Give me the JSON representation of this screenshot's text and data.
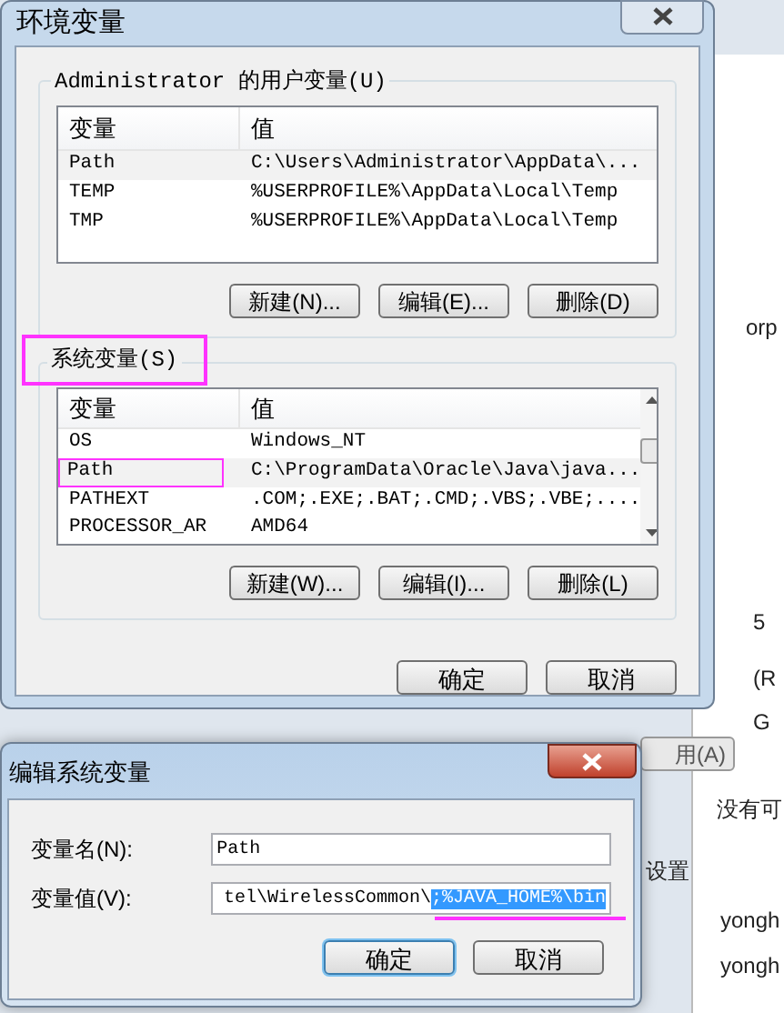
{
  "main_dialog": {
    "title": "环境变量",
    "user_group": {
      "label": "Administrator 的用户变量(U)",
      "columns": [
        "变量",
        "值"
      ],
      "rows": [
        {
          "name": "Path",
          "value": "C:\\Users\\Administrator\\AppData\\...",
          "selected": true
        },
        {
          "name": "TEMP",
          "value": "%USERPROFILE%\\AppData\\Local\\Temp",
          "selected": false
        },
        {
          "name": "TMP",
          "value": "%USERPROFILE%\\AppData\\Local\\Temp",
          "selected": false
        }
      ],
      "buttons": [
        "新建(N)...",
        "编辑(E)...",
        "删除(D)"
      ]
    },
    "system_group": {
      "label": "系统变量(S)",
      "columns": [
        "变量",
        "值"
      ],
      "rows": [
        {
          "name": "OS",
          "value": "Windows_NT",
          "selected": false
        },
        {
          "name": "Path",
          "value": "C:\\ProgramData\\Oracle\\Java\\java...",
          "selected": true
        },
        {
          "name": "PATHEXT",
          "value": ".COM;.EXE;.BAT;.CMD;.VBS;.VBE;....",
          "selected": false
        },
        {
          "name": "PROCESSOR_AR",
          "value": "AMD64",
          "selected": false
        }
      ],
      "buttons": [
        "新建(W)...",
        "编辑(I)...",
        "删除(L)"
      ]
    },
    "buttons": [
      "确定",
      "取消"
    ]
  },
  "edit_dialog": {
    "title": "编辑系统变量",
    "fields": [
      {
        "label": "变量名(N):",
        "value": "Path"
      },
      {
        "label": "变量值(V):",
        "value": "tel\\WirelessCommon\\",
        "selected_text": ";%JAVA_HOME%\\bin"
      }
    ],
    "buttons": [
      "确定",
      "取消"
    ]
  },
  "background": {
    "apply_button": "用(A)",
    "fragments": [
      "orp",
      "5",
      "(R",
      "G",
      "没有可",
      "设置",
      "yongh",
      "yongh"
    ]
  }
}
